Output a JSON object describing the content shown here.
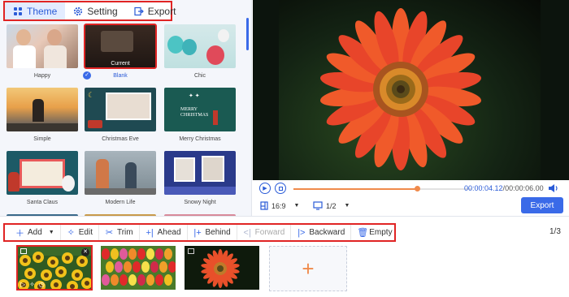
{
  "tabs": [
    {
      "label": "Theme",
      "icon": "grid-icon",
      "active": true
    },
    {
      "label": "Setting",
      "icon": "gear-icon",
      "active": false
    },
    {
      "label": "Export",
      "icon": "export-icon",
      "active": false
    }
  ],
  "themes": [
    {
      "label": "Happy",
      "selected": false
    },
    {
      "label": "Blank",
      "selected": true,
      "tag": "Current"
    },
    {
      "label": "Chic",
      "selected": false
    },
    {
      "label": "Simple",
      "selected": false
    },
    {
      "label": "Christmas Eve",
      "selected": false
    },
    {
      "label": "Merry Christmas",
      "selected": false
    },
    {
      "label": "Santa Claus",
      "selected": false
    },
    {
      "label": "Modern Life",
      "selected": false
    },
    {
      "label": "Snowy Night",
      "selected": false
    }
  ],
  "theme_thumb_texts": {
    "merry": "MERRY CHRISTMAS"
  },
  "player": {
    "current_time": "00:00:04.12",
    "total_time": "00:00:06.00",
    "progress": 0.69,
    "aspect_ratio": "16:9",
    "page_ratio": "1/2",
    "export_label": "Export"
  },
  "toolbar": [
    {
      "label": "Add",
      "icon": "plus-icon",
      "disabled": false,
      "dropdown": true
    },
    {
      "label": "Edit",
      "icon": "wand-icon",
      "disabled": false
    },
    {
      "label": "Trim",
      "icon": "scissors-icon",
      "disabled": false
    },
    {
      "label": "Ahead",
      "icon": "insert-before-icon",
      "disabled": false
    },
    {
      "label": "Behind",
      "icon": "insert-after-icon",
      "disabled": false
    },
    {
      "label": "Forward",
      "icon": "move-forward-icon",
      "disabled": true
    },
    {
      "label": "Backward",
      "icon": "move-backward-icon",
      "disabled": false
    },
    {
      "label": "Empty",
      "icon": "trash-icon",
      "disabled": false
    }
  ],
  "page_indicator": "1/3",
  "colors": {
    "accent": "#3a6ae8",
    "highlight": "#e02424",
    "progress": "#f08a4b"
  }
}
